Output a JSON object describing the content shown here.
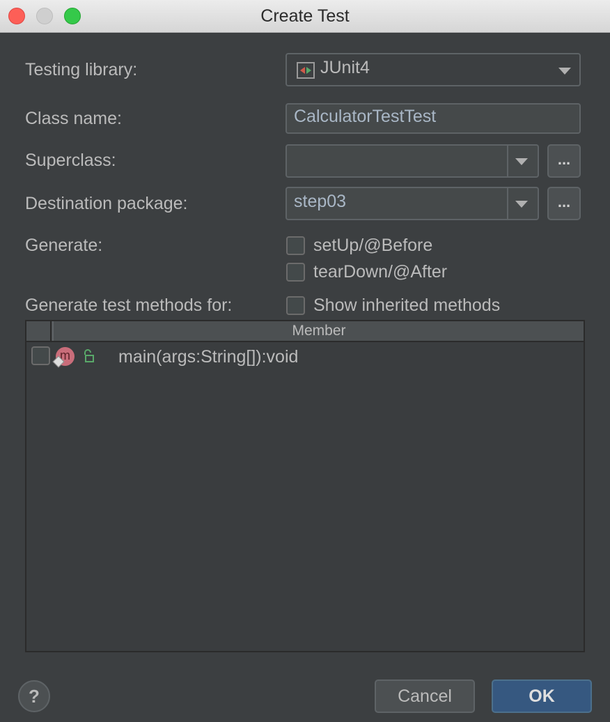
{
  "window": {
    "title": "Create Test"
  },
  "form": {
    "testing_library": {
      "label": "Testing library:",
      "value": "JUnit4"
    },
    "class_name": {
      "label": "Class name:",
      "value": "CalculatorTestTest"
    },
    "superclass": {
      "label": "Superclass:",
      "value": "",
      "browse_label": "..."
    },
    "destination_package": {
      "label": "Destination package:",
      "value": "step03",
      "browse_label": "..."
    },
    "generate": {
      "label": "Generate:",
      "options": [
        {
          "label": "setUp/@Before",
          "checked": false
        },
        {
          "label": "tearDown/@After",
          "checked": false
        }
      ]
    },
    "methods_for": {
      "label": "Generate test methods for:",
      "show_inherited_label": "Show inherited methods",
      "show_inherited_checked": false
    }
  },
  "table": {
    "column_header": "Member",
    "rows": [
      {
        "icon": "method-icon",
        "icon_letter": "m",
        "visibility_icon": "unlocked-icon",
        "signature": "main(args:String[]):void",
        "checked": false
      }
    ]
  },
  "footer": {
    "help_label": "?",
    "cancel_label": "Cancel",
    "ok_label": "OK"
  },
  "colors": {
    "background": "#3c3f41",
    "ok_button": "#365880",
    "field_text": "#a9b7c6"
  }
}
